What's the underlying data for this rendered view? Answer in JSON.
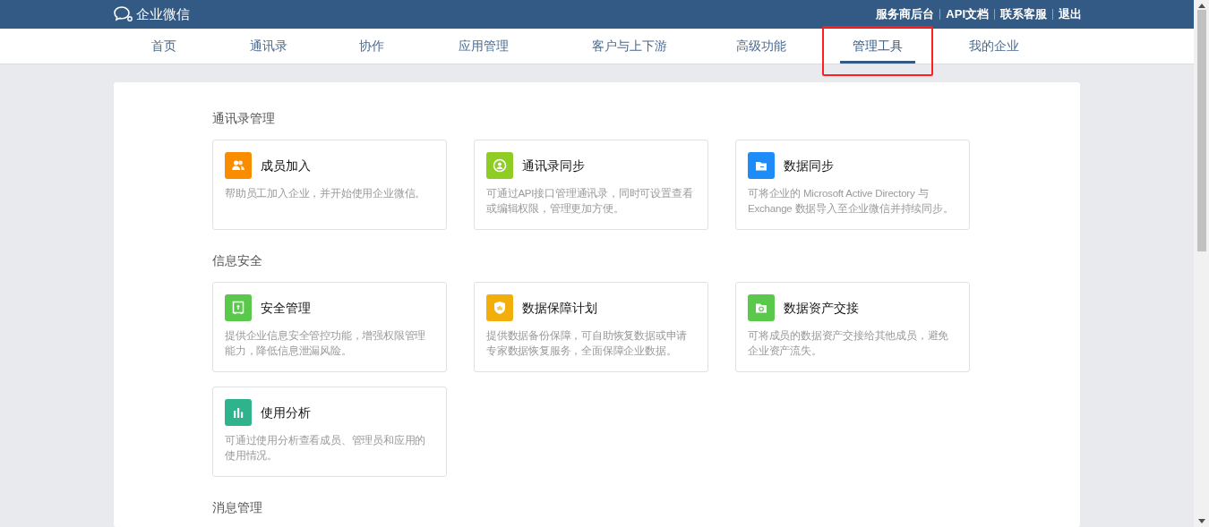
{
  "header": {
    "logo_text": "企业微信",
    "links": [
      "服务商后台",
      "API文档",
      "联系客服",
      "退出"
    ]
  },
  "tabs": [
    {
      "label": "首页",
      "selected": false,
      "annotated": false
    },
    {
      "label": "通讯录",
      "selected": false,
      "annotated": false
    },
    {
      "label": "协作",
      "selected": false,
      "annotated": false
    },
    {
      "label": "应用管理",
      "selected": false,
      "annotated": false
    },
    {
      "label": "客户与上下游",
      "selected": false,
      "annotated": false
    },
    {
      "label": "高级功能",
      "selected": false,
      "annotated": false
    },
    {
      "label": "管理工具",
      "selected": true,
      "annotated": true
    },
    {
      "label": "我的企业",
      "selected": false,
      "annotated": false
    }
  ],
  "sections": [
    {
      "title": "通讯录管理",
      "cards": [
        {
          "title": "成员加入",
          "description": "帮助员工加入企业，并开始使用企业微信。",
          "kind": "people",
          "color": "#fa8c00"
        },
        {
          "title": "通讯录同步",
          "description": "可通过API接口管理通讯录，同时可设置查看或编辑权限，管理更加方便。",
          "kind": "sync",
          "color": "#8fcc24"
        },
        {
          "title": "数据同步",
          "description": "可将企业的 Microsoft Active Directory 与 Exchange 数据导入至企业微信并持续同步。",
          "kind": "folder",
          "color": "#1d8bf8"
        }
      ]
    },
    {
      "title": "信息安全",
      "cards": [
        {
          "title": "安全管理",
          "description": "提供企业信息安全管控功能，增强权限管理能力，降低信息泄漏风险。",
          "kind": "safe",
          "color": "#5ac84a"
        },
        {
          "title": "数据保障计划",
          "description": "提供数据备份保障，可自助恢复数据或申请专家数据恢复服务，全面保障企业数据。",
          "kind": "shield",
          "color": "#f2ae0a"
        },
        {
          "title": "数据资产交接",
          "description": "可将成员的数据资产交接给其他成员，避免企业资产流失。",
          "kind": "folder-cycle",
          "color": "#5ac84a"
        },
        {
          "title": "使用分析",
          "description": "可通过使用分析查看成员、管理员和应用的使用情况。",
          "kind": "bars",
          "color": "#2fb38c"
        }
      ]
    },
    {
      "title": "消息管理"
    }
  ]
}
